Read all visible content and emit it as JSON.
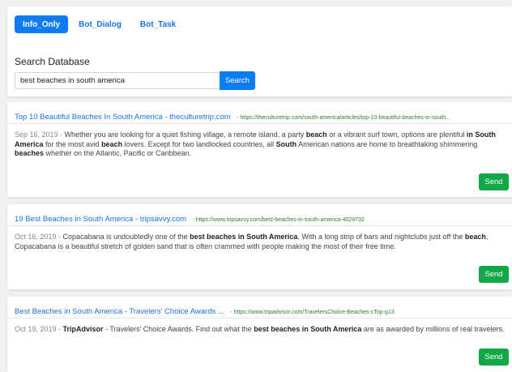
{
  "tabs": [
    {
      "label": "Info_Only",
      "active": true
    },
    {
      "label": "Bot_Dialog",
      "active": false
    },
    {
      "label": "Bot_Task",
      "active": false
    }
  ],
  "search": {
    "title": "Search Database",
    "value": "best beaches in south america",
    "button_label": "Search"
  },
  "results": [
    {
      "title": "Top 10 Beautiful Beaches In South America - theculturetrip.com",
      "url": "- https://theculturetrip.com/south-america/articles/top-10-beautiful-beaches-in-south...",
      "date": "Sep 16, 2019 - ",
      "snippet_parts": [
        {
          "text": "Whether you are looking for a quiet fishing village, a remote island, a party ",
          "bold": false
        },
        {
          "text": "beach",
          "bold": true
        },
        {
          "text": " or a vibrant surf town, options are plentiful ",
          "bold": false
        },
        {
          "text": "in South America",
          "bold": true
        },
        {
          "text": " for the most avid ",
          "bold": false
        },
        {
          "text": "beach",
          "bold": true
        },
        {
          "text": " lovers. Except for two landlocked countries, all ",
          "bold": false
        },
        {
          "text": "South",
          "bold": true
        },
        {
          "text": " American nations are home to breathtaking shimmering ",
          "bold": false
        },
        {
          "text": "beaches",
          "bold": true
        },
        {
          "text": " whether on the Atlantic, Pacific or Caribbean.",
          "bold": false
        }
      ],
      "send_label": "Send"
    },
    {
      "title": "19 Best Beaches in South America - tripsavvy.com",
      "url": "- https://www.tripsavvy.com/best-beaches-in-south-america-4029732",
      "date": "Oct 16, 2019 - ",
      "snippet_parts": [
        {
          "text": "Copacabana is undoubtedly one of the ",
          "bold": false
        },
        {
          "text": "best beaches in South America",
          "bold": true
        },
        {
          "text": ". With a long strip of bars and nightclubs just off the ",
          "bold": false
        },
        {
          "text": "beach",
          "bold": true
        },
        {
          "text": ", Copacabana is a beautiful stretch of golden sand that is often crammed with people making the most of their free time.",
          "bold": false
        }
      ],
      "send_label": "Send"
    },
    {
      "title": "Best Beaches in South America - Travelers' Choice Awards ...",
      "url": "- https://www.tripadvisor.com/TravelersChoice-Beaches-cTop-g13",
      "date": "Oct 19, 2019 - ",
      "snippet_parts": [
        {
          "text": "TripAdvisor",
          "bold": true
        },
        {
          "text": " - Travelers' Choice Awards. Find out what the ",
          "bold": false
        },
        {
          "text": "best beaches in South America",
          "bold": true
        },
        {
          "text": " are as awarded by millions of real travelers.",
          "bold": false
        }
      ],
      "send_label": "Send"
    }
  ]
}
